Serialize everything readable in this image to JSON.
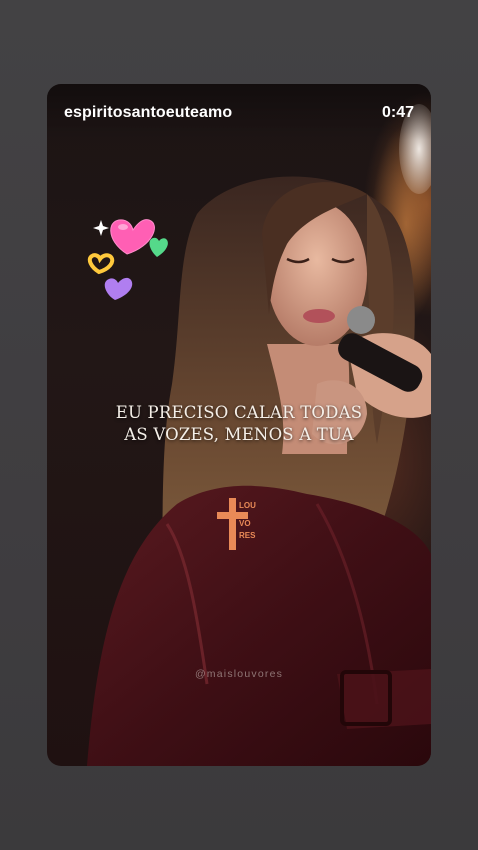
{
  "story": {
    "username": "espiritosantoeuteamo",
    "time_remaining": "0:47",
    "caption_lines": [
      "EU PRECISO CALAR TODAS",
      "AS VOZES, MENOS A TUA"
    ],
    "logo_text": [
      "LOU",
      "VO",
      "RES"
    ],
    "watermark": "@maislouvores"
  },
  "colors": {
    "background": "#434244",
    "heart_pink": "#ff5fb4",
    "heart_green": "#55d98a",
    "heart_yellow": "#ffc93c",
    "heart_purple": "#b07ef0",
    "logo_accent": "#e98a57"
  },
  "icons": [
    "sparkle-icon",
    "pink-heart-icon",
    "green-heart-icon",
    "yellow-heart-outline-icon",
    "purple-heart-icon",
    "cross-logo-icon"
  ]
}
